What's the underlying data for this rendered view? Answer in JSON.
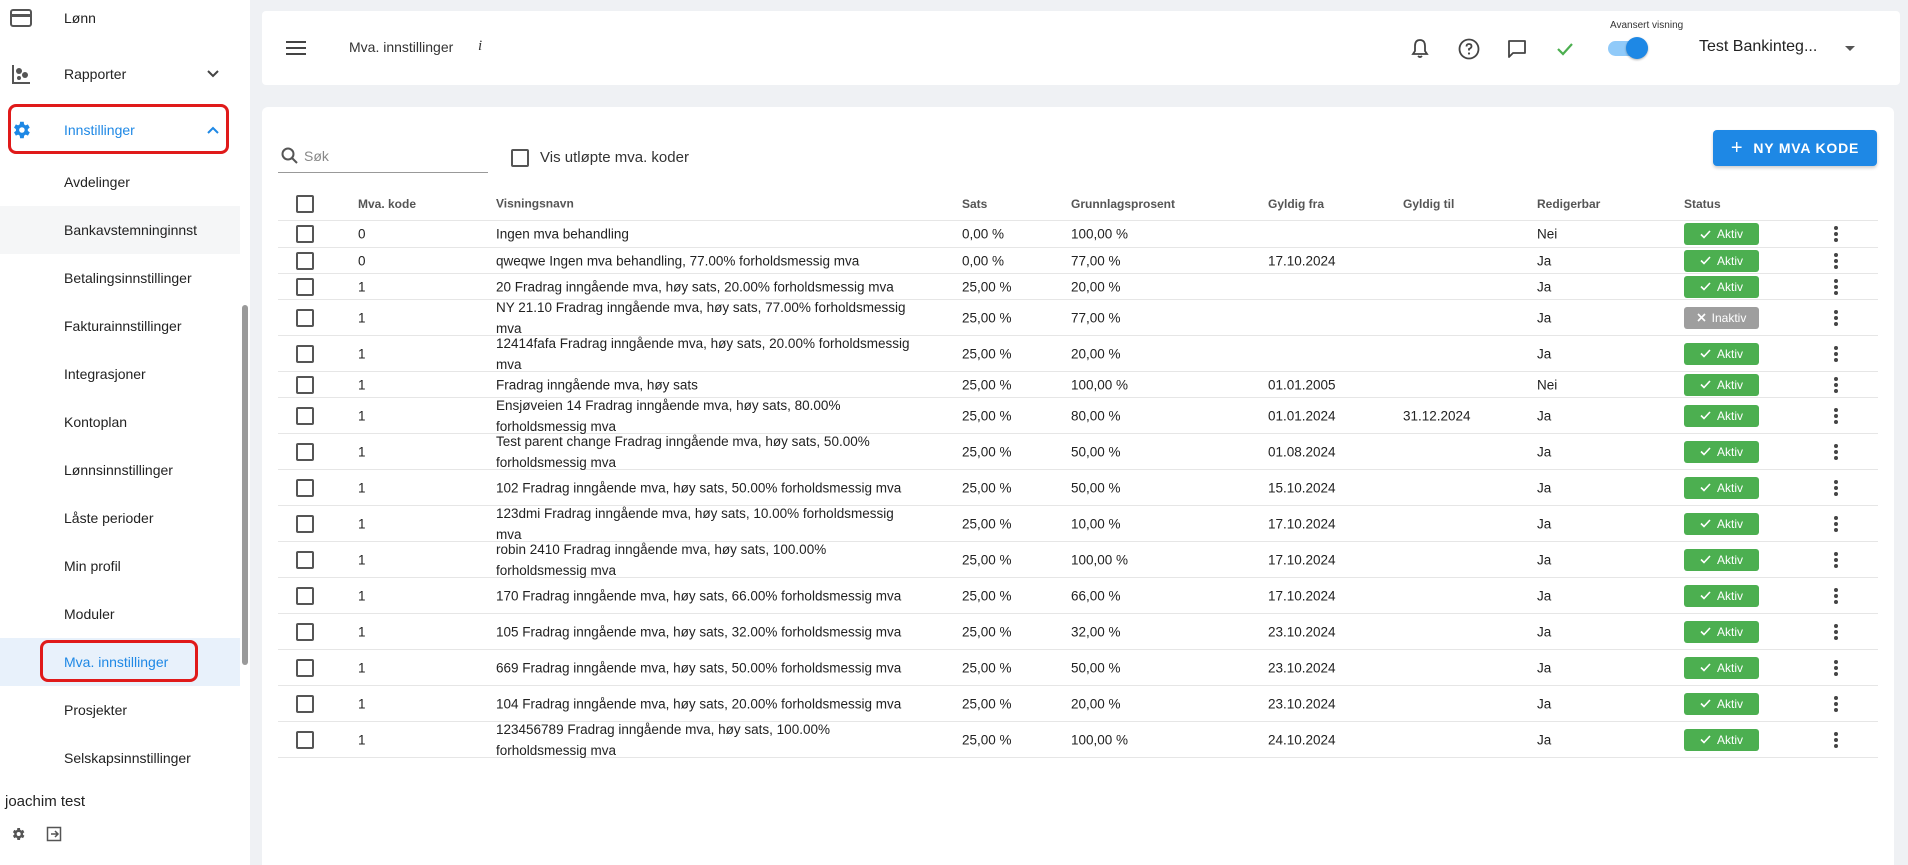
{
  "sidebar": {
    "items": [
      {
        "label": "Lønn",
        "icon": "card-icon"
      },
      {
        "label": "Rapporter",
        "icon": "reports-icon"
      },
      {
        "label": "Innstillinger",
        "icon": "gear-icon"
      }
    ],
    "subitems": [
      "Avdelinger",
      "Bankavstemninginnst",
      "Betalingsinnstillinger",
      "Fakturainnstillinger",
      "Integrasjoner",
      "Kontoplan",
      "Lønnsinnstillinger",
      "Låste perioder",
      "Min profil",
      "Moduler",
      "Mva. innstillinger",
      "Prosjekter",
      "Selskapsinnstillinger"
    ],
    "active_subitem": "Mva. innstillinger",
    "user_name": "joachim test",
    "accent_color": "#1e88e5",
    "highlight_color": "#e01a1a"
  },
  "header": {
    "title": "Mva. innstillinger",
    "info_label": "i",
    "advanced_view_label": "Avansert visning",
    "advanced_view_on": true,
    "company_name": "Test Bankinteg..."
  },
  "toolbar": {
    "search_placeholder": "Søk",
    "show_expired_label": "Vis utløpte mva. koder",
    "show_expired_checked": false,
    "new_button_label": "NY MVA KODE"
  },
  "table": {
    "columns": [
      "Mva. kode",
      "Visningsnavn",
      "Sats",
      "Grunnlagsprosent",
      "Gyldig fra",
      "Gyldig til",
      "Redigerbar",
      "Status"
    ],
    "rows": [
      {
        "kode": "0",
        "navn": "Ingen mva behandling",
        "sats": "0,00 %",
        "grunn": "100,00 %",
        "fra": "",
        "til": "",
        "red": "Nei",
        "status": "Aktiv"
      },
      {
        "kode": "0",
        "navn": "qweqwe Ingen mva behandling, 77.00% forholdsmessig mva",
        "sats": "0,00 %",
        "grunn": "77,00 %",
        "fra": "17.10.2024",
        "til": "",
        "red": "Ja",
        "status": "Aktiv"
      },
      {
        "kode": "1",
        "navn": "20 Fradrag inngående mva, høy sats, 20.00% forholdsmessig mva",
        "sats": "25,00 %",
        "grunn": "20,00 %",
        "fra": "",
        "til": "",
        "red": "Ja",
        "status": "Aktiv"
      },
      {
        "kode": "1",
        "navn": "NY 21.10 Fradrag inngående mva, høy sats, 77.00% forholdsmessig mva",
        "sats": "25,00 %",
        "grunn": "77,00 %",
        "fra": "",
        "til": "",
        "red": "Ja",
        "status": "Inaktiv"
      },
      {
        "kode": "1",
        "navn": "12414fafa Fradrag inngående mva, høy sats, 20.00% forholdsmessig mva",
        "sats": "25,00 %",
        "grunn": "20,00 %",
        "fra": "",
        "til": "",
        "red": "Ja",
        "status": "Aktiv"
      },
      {
        "kode": "1",
        "navn": "Fradrag inngående mva, høy sats",
        "sats": "25,00 %",
        "grunn": "100,00 %",
        "fra": "01.01.2005",
        "til": "",
        "red": "Nei",
        "status": "Aktiv"
      },
      {
        "kode": "1",
        "navn": "Ensjøveien 14 Fradrag inngående mva, høy sats, 80.00% forholdsmessig mva",
        "sats": "25,00 %",
        "grunn": "80,00 %",
        "fra": "01.01.2024",
        "til": "31.12.2024",
        "red": "Ja",
        "status": "Aktiv"
      },
      {
        "kode": "1",
        "navn": "Test parent change Fradrag inngående mva, høy sats, 50.00% forholdsmessig mva",
        "sats": "25,00 %",
        "grunn": "50,00 %",
        "fra": "01.08.2024",
        "til": "",
        "red": "Ja",
        "status": "Aktiv"
      },
      {
        "kode": "1",
        "navn": "102 Fradrag inngående mva, høy sats, 50.00% forholdsmessig mva",
        "sats": "25,00 %",
        "grunn": "50,00 %",
        "fra": "15.10.2024",
        "til": "",
        "red": "Ja",
        "status": "Aktiv"
      },
      {
        "kode": "1",
        "navn": "123dmi Fradrag inngående mva, høy sats, 10.00% forholdsmessig mva",
        "sats": "25,00 %",
        "grunn": "10,00 %",
        "fra": "17.10.2024",
        "til": "",
        "red": "Ja",
        "status": "Aktiv"
      },
      {
        "kode": "1",
        "navn": "robin 2410 Fradrag inngående mva, høy sats, 100.00% forholdsmessig mva",
        "sats": "25,00 %",
        "grunn": "100,00 %",
        "fra": "17.10.2024",
        "til": "",
        "red": "Ja",
        "status": "Aktiv"
      },
      {
        "kode": "1",
        "navn": "170 Fradrag inngående mva, høy sats, 66.00% forholdsmessig mva",
        "sats": "25,00 %",
        "grunn": "66,00 %",
        "fra": "17.10.2024",
        "til": "",
        "red": "Ja",
        "status": "Aktiv"
      },
      {
        "kode": "1",
        "navn": "105 Fradrag inngående mva, høy sats, 32.00% forholdsmessig mva",
        "sats": "25,00 %",
        "grunn": "32,00 %",
        "fra": "23.10.2024",
        "til": "",
        "red": "Ja",
        "status": "Aktiv"
      },
      {
        "kode": "1",
        "navn": "669 Fradrag inngående mva, høy sats, 50.00% forholdsmessig mva",
        "sats": "25,00 %",
        "grunn": "50,00 %",
        "fra": "23.10.2024",
        "til": "",
        "red": "Ja",
        "status": "Aktiv"
      },
      {
        "kode": "1",
        "navn": "104 Fradrag inngående mva, høy sats, 20.00% forholdsmessig mva",
        "sats": "25,00 %",
        "grunn": "20,00 %",
        "fra": "23.10.2024",
        "til": "",
        "red": "Ja",
        "status": "Aktiv"
      },
      {
        "kode": "1",
        "navn": "123456789 Fradrag inngående mva, høy sats, 100.00% forholdsmessig mva",
        "sats": "25,00 %",
        "grunn": "100,00 %",
        "fra": "24.10.2024",
        "til": "",
        "red": "Ja",
        "status": "Aktiv"
      }
    ],
    "status_colors": {
      "Aktiv": "#4caf50",
      "Inaktiv": "#9e9e9e"
    }
  }
}
